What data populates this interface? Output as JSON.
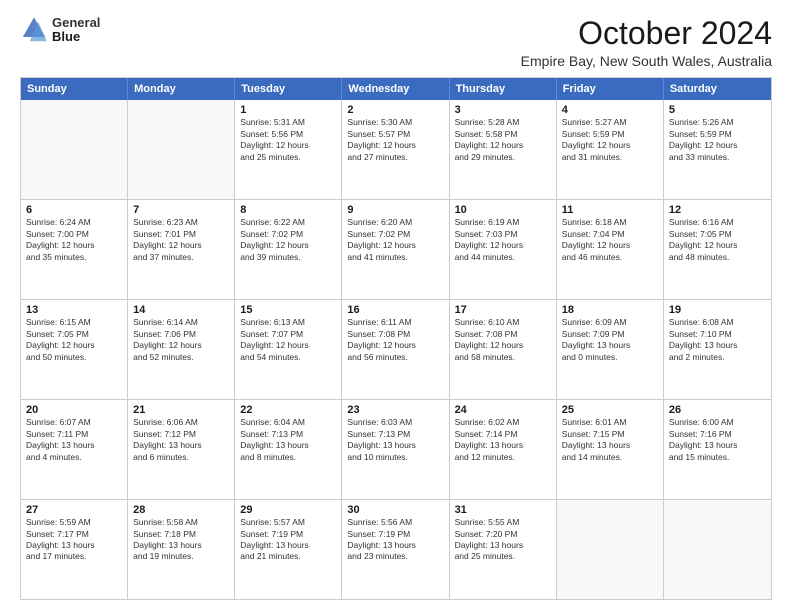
{
  "logo": {
    "line1": "General",
    "line2": "Blue"
  },
  "title": "October 2024",
  "location": "Empire Bay, New South Wales, Australia",
  "headers": [
    "Sunday",
    "Monday",
    "Tuesday",
    "Wednesday",
    "Thursday",
    "Friday",
    "Saturday"
  ],
  "rows": [
    [
      {
        "date": "",
        "info": ""
      },
      {
        "date": "",
        "info": ""
      },
      {
        "date": "1",
        "info": "Sunrise: 5:31 AM\nSunset: 5:56 PM\nDaylight: 12 hours\nand 25 minutes."
      },
      {
        "date": "2",
        "info": "Sunrise: 5:30 AM\nSunset: 5:57 PM\nDaylight: 12 hours\nand 27 minutes."
      },
      {
        "date": "3",
        "info": "Sunrise: 5:28 AM\nSunset: 5:58 PM\nDaylight: 12 hours\nand 29 minutes."
      },
      {
        "date": "4",
        "info": "Sunrise: 5:27 AM\nSunset: 5:59 PM\nDaylight: 12 hours\nand 31 minutes."
      },
      {
        "date": "5",
        "info": "Sunrise: 5:26 AM\nSunset: 5:59 PM\nDaylight: 12 hours\nand 33 minutes."
      }
    ],
    [
      {
        "date": "6",
        "info": "Sunrise: 6:24 AM\nSunset: 7:00 PM\nDaylight: 12 hours\nand 35 minutes."
      },
      {
        "date": "7",
        "info": "Sunrise: 6:23 AM\nSunset: 7:01 PM\nDaylight: 12 hours\nand 37 minutes."
      },
      {
        "date": "8",
        "info": "Sunrise: 6:22 AM\nSunset: 7:02 PM\nDaylight: 12 hours\nand 39 minutes."
      },
      {
        "date": "9",
        "info": "Sunrise: 6:20 AM\nSunset: 7:02 PM\nDaylight: 12 hours\nand 41 minutes."
      },
      {
        "date": "10",
        "info": "Sunrise: 6:19 AM\nSunset: 7:03 PM\nDaylight: 12 hours\nand 44 minutes."
      },
      {
        "date": "11",
        "info": "Sunrise: 6:18 AM\nSunset: 7:04 PM\nDaylight: 12 hours\nand 46 minutes."
      },
      {
        "date": "12",
        "info": "Sunrise: 6:16 AM\nSunset: 7:05 PM\nDaylight: 12 hours\nand 48 minutes."
      }
    ],
    [
      {
        "date": "13",
        "info": "Sunrise: 6:15 AM\nSunset: 7:05 PM\nDaylight: 12 hours\nand 50 minutes."
      },
      {
        "date": "14",
        "info": "Sunrise: 6:14 AM\nSunset: 7:06 PM\nDaylight: 12 hours\nand 52 minutes."
      },
      {
        "date": "15",
        "info": "Sunrise: 6:13 AM\nSunset: 7:07 PM\nDaylight: 12 hours\nand 54 minutes."
      },
      {
        "date": "16",
        "info": "Sunrise: 6:11 AM\nSunset: 7:08 PM\nDaylight: 12 hours\nand 56 minutes."
      },
      {
        "date": "17",
        "info": "Sunrise: 6:10 AM\nSunset: 7:08 PM\nDaylight: 12 hours\nand 58 minutes."
      },
      {
        "date": "18",
        "info": "Sunrise: 6:09 AM\nSunset: 7:09 PM\nDaylight: 13 hours\nand 0 minutes."
      },
      {
        "date": "19",
        "info": "Sunrise: 6:08 AM\nSunset: 7:10 PM\nDaylight: 13 hours\nand 2 minutes."
      }
    ],
    [
      {
        "date": "20",
        "info": "Sunrise: 6:07 AM\nSunset: 7:11 PM\nDaylight: 13 hours\nand 4 minutes."
      },
      {
        "date": "21",
        "info": "Sunrise: 6:06 AM\nSunset: 7:12 PM\nDaylight: 13 hours\nand 6 minutes."
      },
      {
        "date": "22",
        "info": "Sunrise: 6:04 AM\nSunset: 7:13 PM\nDaylight: 13 hours\nand 8 minutes."
      },
      {
        "date": "23",
        "info": "Sunrise: 6:03 AM\nSunset: 7:13 PM\nDaylight: 13 hours\nand 10 minutes."
      },
      {
        "date": "24",
        "info": "Sunrise: 6:02 AM\nSunset: 7:14 PM\nDaylight: 13 hours\nand 12 minutes."
      },
      {
        "date": "25",
        "info": "Sunrise: 6:01 AM\nSunset: 7:15 PM\nDaylight: 13 hours\nand 14 minutes."
      },
      {
        "date": "26",
        "info": "Sunrise: 6:00 AM\nSunset: 7:16 PM\nDaylight: 13 hours\nand 15 minutes."
      }
    ],
    [
      {
        "date": "27",
        "info": "Sunrise: 5:59 AM\nSunset: 7:17 PM\nDaylight: 13 hours\nand 17 minutes."
      },
      {
        "date": "28",
        "info": "Sunrise: 5:58 AM\nSunset: 7:18 PM\nDaylight: 13 hours\nand 19 minutes."
      },
      {
        "date": "29",
        "info": "Sunrise: 5:57 AM\nSunset: 7:19 PM\nDaylight: 13 hours\nand 21 minutes."
      },
      {
        "date": "30",
        "info": "Sunrise: 5:56 AM\nSunset: 7:19 PM\nDaylight: 13 hours\nand 23 minutes."
      },
      {
        "date": "31",
        "info": "Sunrise: 5:55 AM\nSunset: 7:20 PM\nDaylight: 13 hours\nand 25 minutes."
      },
      {
        "date": "",
        "info": ""
      },
      {
        "date": "",
        "info": ""
      }
    ]
  ]
}
